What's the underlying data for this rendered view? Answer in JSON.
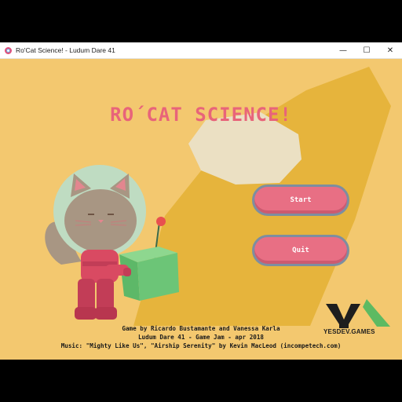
{
  "window": {
    "title": "Ro'Cat Science! - Ludum Dare 41",
    "minimize_glyph": "—",
    "maximize_glyph": "☐",
    "close_glyph": "✕"
  },
  "game": {
    "title": "RO´CAT SCIENCE!",
    "menu": {
      "start_label": "Start",
      "quit_label": "Quit"
    },
    "logo": {
      "text": "YESDEV.GAMES"
    },
    "credits": [
      "Game by Ricardo Bustamante and Vanessa Karla",
      "Ludum Dare 41 - Game Jam - apr 2018",
      "Music: \"Mighty Like Us\", \"Airship Serenity\" by Kevin MacLeod (incompetech.com)"
    ]
  },
  "colors": {
    "background": "#f3c86f",
    "title": "#e8647a",
    "button": "#e86f84",
    "button_border": "#7d8ea0",
    "swoosh": "#e6b43c",
    "moon": "#ebe0c3"
  }
}
